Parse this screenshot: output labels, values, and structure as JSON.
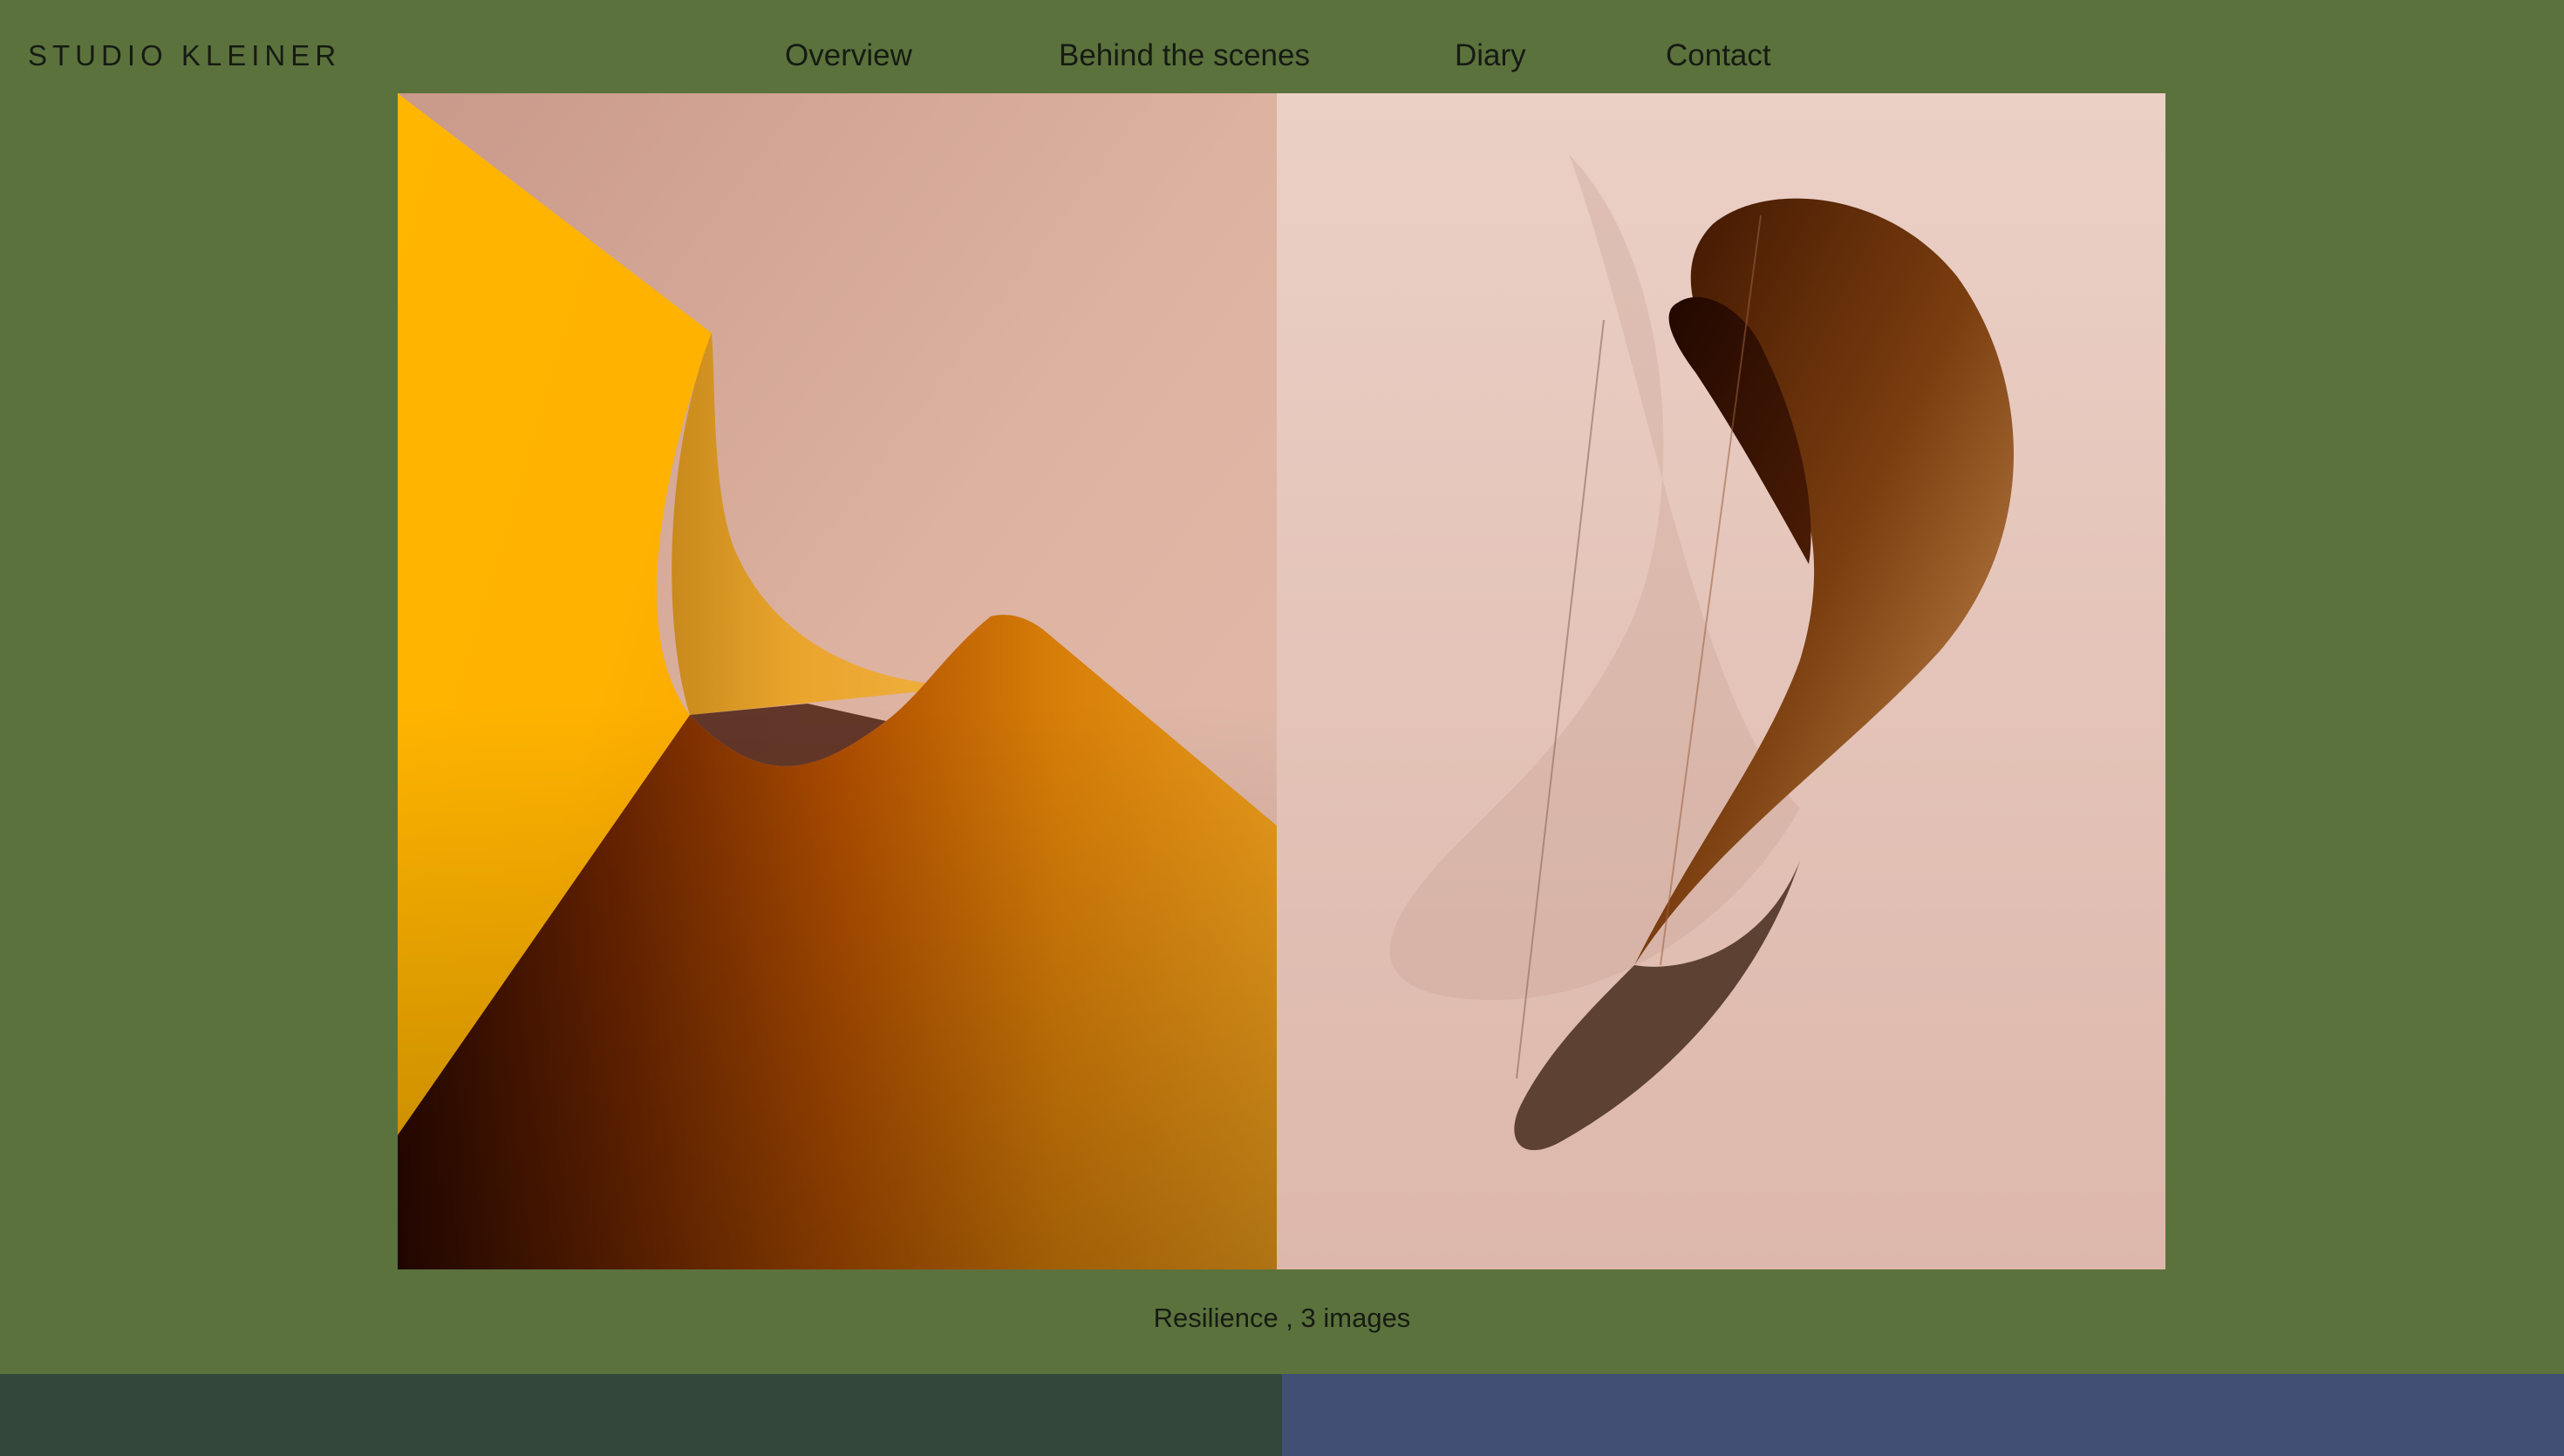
{
  "header": {
    "brand": "STUDIO KLEINER",
    "nav": [
      {
        "label": "Overview"
      },
      {
        "label": "Behind the scenes"
      },
      {
        "label": "Diary"
      },
      {
        "label": "Contact"
      }
    ]
  },
  "gallery": {
    "caption": "Resilience , 3 images"
  },
  "colors": {
    "page_background": "#5c723d",
    "footer_left": "#33473a",
    "footer_right": "#404f73",
    "text": "#161b12"
  }
}
